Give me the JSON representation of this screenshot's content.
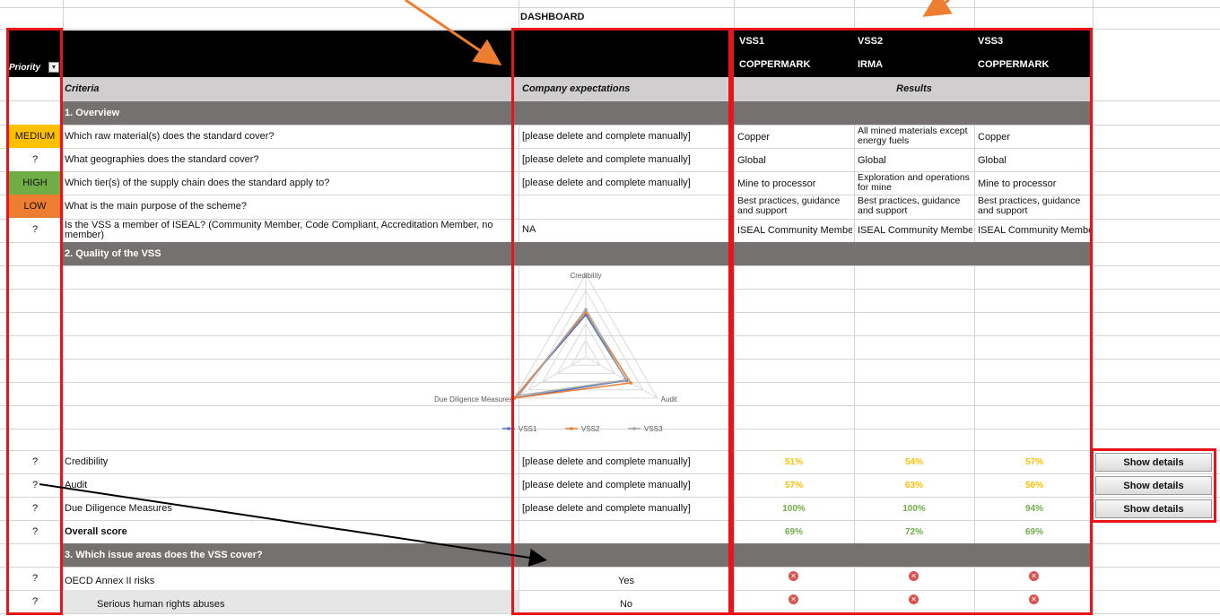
{
  "dashboard_title": "DASHBOARD",
  "priority_header": "Priority",
  "headers": {
    "criteria": "Criteria",
    "company_expectations": "Company expectations",
    "results": "Results",
    "vss": [
      {
        "code": "VSS1",
        "name": "COPPERMARK"
      },
      {
        "code": "VSS2",
        "name": "IRMA"
      },
      {
        "code": "VSS3",
        "name": "COPPERMARK"
      }
    ]
  },
  "sections": {
    "overview": "1. Overview",
    "quality": "2. Quality of the VSS",
    "issue_areas": "3. Which issue areas does the VSS cover?"
  },
  "overview_rows": [
    {
      "priority": "MEDIUM",
      "priority_color": "#ffc000",
      "criteria": "Which raw material(s) does the standard cover?",
      "expectation": "[please delete and complete manually]",
      "results": [
        "Copper",
        "All mined materials except energy fuels",
        "Copper"
      ]
    },
    {
      "priority": "?",
      "priority_color": "#ffffff",
      "criteria": "What geographies does the standard cover?",
      "expectation": "[please delete and complete manually]",
      "results": [
        "Global",
        "Global",
        "Global"
      ]
    },
    {
      "priority": "HIGH",
      "priority_color": "#70ad47",
      "criteria": "Which tier(s) of the supply chain does the standard apply to?",
      "expectation": "[please delete and complete manually]",
      "results": [
        "Mine to processor",
        "Exploration and operations for mine",
        "Mine to processor"
      ]
    },
    {
      "priority": "LOW",
      "priority_color": "#ed7d31",
      "criteria": "What is the main purpose of the scheme?",
      "expectation": "",
      "results": [
        "Best practices, guidance and support",
        "Best practices, guidance and support",
        "Best practices, guidance and support"
      ]
    },
    {
      "priority": "?",
      "priority_color": "#ffffff",
      "criteria": "Is the VSS a member of ISEAL? (Community Member, Code Compliant, Accreditation Member, no member)",
      "expectation": "NA",
      "results": [
        "ISEAL Community Member",
        "ISEAL Community Member",
        "ISEAL Community Member"
      ]
    }
  ],
  "chart_data": {
    "type": "radar",
    "axes": [
      "Credibility",
      "Audit",
      "Due Diligence Measures"
    ],
    "series": [
      {
        "name": "VSS1",
        "values": [
          51,
          57,
          100
        ],
        "color": "#4472c4"
      },
      {
        "name": "VSS2",
        "values": [
          54,
          63,
          100
        ],
        "color": "#ed7d31"
      },
      {
        "name": "VSS3",
        "values": [
          57,
          56,
          94
        ],
        "color": "#a5a5a5"
      }
    ],
    "range": [
      0,
      100
    ],
    "legend_position": "bottom"
  },
  "score_rows": [
    {
      "priority": "?",
      "criteria": "Credibility",
      "expectation": "[please delete and complete manually]",
      "scores": [
        "51%",
        "54%",
        "57%"
      ],
      "score_colors": [
        "#ffc000",
        "#ffc000",
        "#ffc000"
      ],
      "button": "Show details"
    },
    {
      "priority": "?",
      "criteria": "Audit",
      "expectation": "[please delete and complete manually]",
      "scores": [
        "57%",
        "63%",
        "56%"
      ],
      "score_colors": [
        "#ffc000",
        "#ffc000",
        "#ffc000"
      ],
      "button": "Show details"
    },
    {
      "priority": "?",
      "criteria": "Due Diligence Measures",
      "expectation": "[please delete and complete manually]",
      "scores": [
        "100%",
        "100%",
        "94%"
      ],
      "score_colors": [
        "#70ad47",
        "#70ad47",
        "#70ad47"
      ],
      "button": "Show details"
    },
    {
      "priority": "?",
      "criteria": "Overall score",
      "expectation": "",
      "scores": [
        "69%",
        "72%",
        "69%"
      ],
      "score_colors": [
        "#70ad47",
        "#70ad47",
        "#70ad47"
      ],
      "button": ""
    }
  ],
  "issue_rows": [
    {
      "priority": "?",
      "criteria": "OECD Annex II risks",
      "expectation": "Yes",
      "icons": [
        "x-circle-icon",
        "x-circle-icon",
        "x-circle-icon"
      ]
    },
    {
      "priority": "?",
      "criteria": "Serious human rights abuses",
      "expectation": "No",
      "icons": [
        "x-circle-icon",
        "x-circle-icon",
        "x-circle-icon"
      ]
    }
  ],
  "annotation_color": "#e8141a",
  "arrow_color": "#ed7d31"
}
